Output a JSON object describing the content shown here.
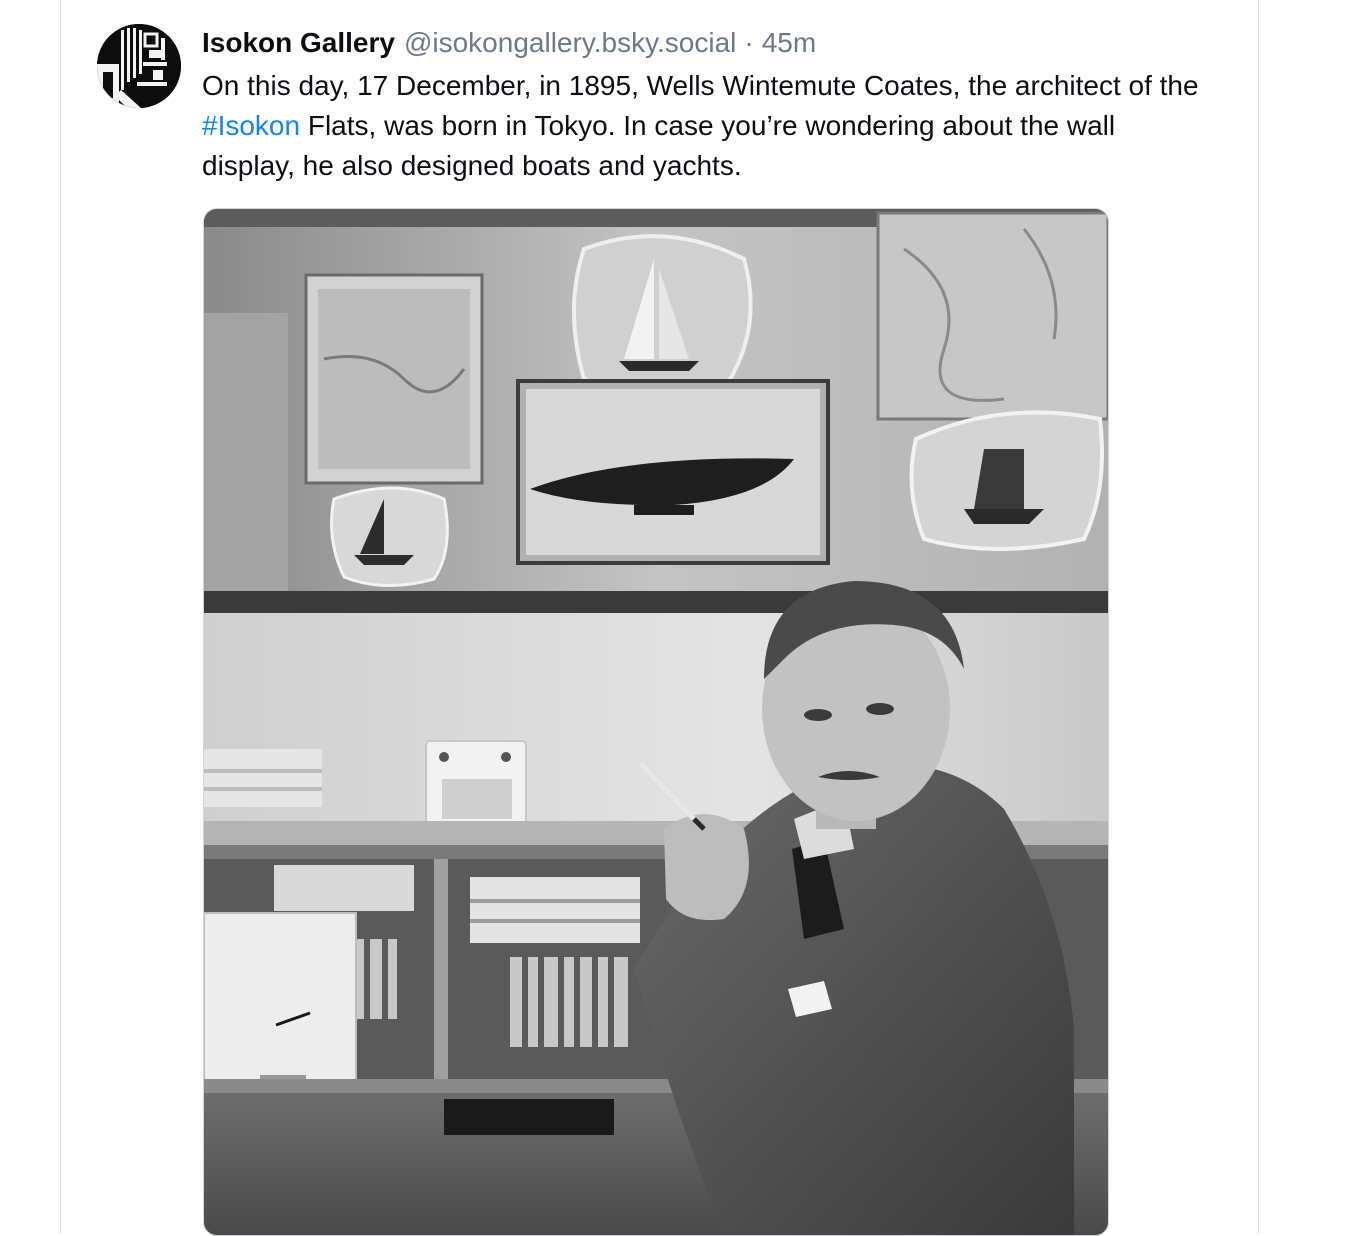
{
  "post": {
    "author": {
      "display_name": "Isokon Gallery",
      "handle": "@isokongallery.bsky.social",
      "avatar_icon": "isokon-logo-avatar"
    },
    "separator": "·",
    "timestamp": "45m",
    "text": {
      "before_hashtag": "On this day, 17 December, in 1895, Wells Wintemute Coates, the architect of the ",
      "hashtag": "#Isokon",
      "after_hashtag": " Flats, was born in Tokyo. In case you’re wondering about the wall display, he also designed boats and yachts."
    },
    "image": {
      "description_icon": "black-and-white-photo",
      "tone": "grayscale"
    }
  },
  "colors": {
    "text": "#0b0f14",
    "muted": "#6b7a8a",
    "link": "#1083fe",
    "border": "#dfe3e8"
  }
}
